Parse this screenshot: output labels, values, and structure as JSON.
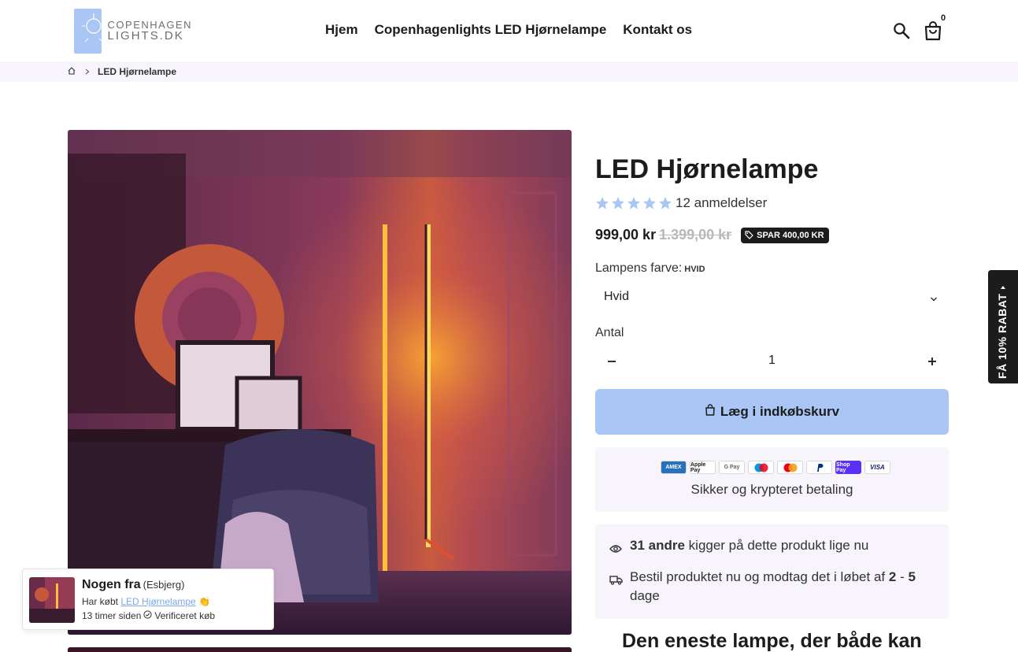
{
  "header": {
    "logo_line1": "COPENHAGEN",
    "logo_line2": "LIGHTS.DK",
    "nav": [
      "Hjem",
      "Copenhagenlights LED Hjørnelampe",
      "Kontakt os"
    ],
    "cart_count": "0"
  },
  "breadcrumb": {
    "current": "LED Hjørnelampe"
  },
  "product": {
    "title": "LED Hjørnelampe",
    "rating_stars": 5,
    "reviews": "12 anmeldelser",
    "price": "999,00 kr",
    "compare_price": "1.399,00 kr",
    "save_badge": "SPAR 400,00 KR",
    "variant_label": "Lampens farve:",
    "variant_value": "HVID",
    "select_value": "Hvid",
    "qty_label": "Antal",
    "qty_value": "1",
    "add_to_cart": "Læg i indkøbskurv"
  },
  "payment": {
    "icons": [
      "AMEX",
      "Apple Pay",
      "G Pay",
      "Maestro",
      "Mastercard",
      "PayPal",
      "Shop Pay",
      "VISA"
    ],
    "text": "Sikker og krypteret betaling"
  },
  "info": {
    "viewers_bold": "31 andre",
    "viewers_text": " kigger på dette produkt lige nu",
    "delivery_text": "Bestil produktet nu og modtag det i løbet af ",
    "delivery_bold1": "2",
    "delivery_sep": " - ",
    "delivery_bold2": "5",
    "delivery_end": " dage"
  },
  "description_heading": "Den eneste lampe, der både kan",
  "side_tab": "FÅ 10% RABAT",
  "popup": {
    "name": "Nogen fra",
    "city": "(Esbjerg)",
    "bought_prefix": "Har købt ",
    "product_link": "LED Hjørnelampe",
    "emoji": "👏",
    "time": "13 timer siden",
    "verified": "Verificeret køb"
  },
  "colors": {
    "accent": "#a9c6f5",
    "dark": "#1c1c1c",
    "panel": "#f7f5fb"
  }
}
